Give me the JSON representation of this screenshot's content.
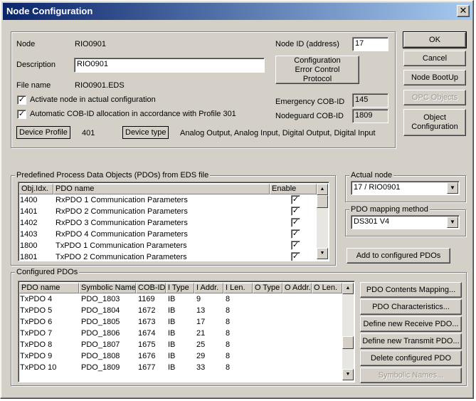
{
  "window": {
    "title": "Node Configuration",
    "close_glyph": "✕"
  },
  "node_info": {
    "node_label": "Node",
    "node_value": "RIO0901",
    "description_label": "Description",
    "description_value": "RIO0901",
    "filename_label": "File name",
    "filename_value": "RIO0901.EDS",
    "activate_label": "Activate node in actual configuration",
    "activate_checked": true,
    "auto_cob_label": "Automatic COB-ID allocation in accordance with Profile 301",
    "auto_cob_checked": true,
    "device_profile_label": "Device Profile",
    "device_profile_value": "401",
    "device_type_label": "Device type",
    "device_type_value": "Analog Output, Analog Input, Digital Output, Digital Input",
    "node_id_label": "Node ID (address)",
    "node_id_value": "17",
    "config_error_button": "Configuration Error Control Protocol",
    "emergency_label": "Emergency COB-ID",
    "emergency_value": "145",
    "nodeguard_label": "Nodeguard COB-ID",
    "nodeguard_value": "1809"
  },
  "side_buttons": {
    "ok": "OK",
    "cancel": "Cancel",
    "node_bootup": "Node BootUp",
    "opc_objects": "OPC Objects",
    "object_configuration": "Object Configuration"
  },
  "predefined": {
    "group_label": "Predefined Process Data Objects (PDOs) from EDS file",
    "columns": [
      "Obj.Idx.",
      "PDO name",
      "Enable"
    ],
    "rows": [
      {
        "idx": "1400",
        "name": "RxPDO 1 Communication Parameters",
        "enabled": true
      },
      {
        "idx": "1401",
        "name": "RxPDO 2 Communication Parameters",
        "enabled": true
      },
      {
        "idx": "1402",
        "name": "RxPDO 3 Communication Parameters",
        "enabled": true
      },
      {
        "idx": "1403",
        "name": "RxPDO 4 Communication Parameters",
        "enabled": true
      },
      {
        "idx": "1800",
        "name": "TxPDO 1 Communication Parameters",
        "enabled": true
      },
      {
        "idx": "1801",
        "name": "TxPDO 2 Communication Parameters",
        "enabled": true
      }
    ]
  },
  "actual_node": {
    "group_label": "Actual node",
    "selected": "17 / RIO0901"
  },
  "pdo_mapping": {
    "group_label": "PDO mapping method",
    "selected": "DS301 V4"
  },
  "add_button": "Add to configured PDOs",
  "configured": {
    "group_label": "Configured PDOs",
    "columns": [
      "PDO name",
      "Symbolic Name",
      "COB-ID",
      "I Type",
      "I Addr.",
      "I Len.",
      "O Type",
      "O Addr.",
      "O Len."
    ],
    "rows": [
      [
        "TxPDO 4",
        "PDO_1803",
        "1169",
        "IB",
        "9",
        "8"
      ],
      [
        "TxPDO 5",
        "PDO_1804",
        "1672",
        "IB",
        "13",
        "8"
      ],
      [
        "TxPDO 6",
        "PDO_1805",
        "1673",
        "IB",
        "17",
        "8"
      ],
      [
        "TxPDO 7",
        "PDO_1806",
        "1674",
        "IB",
        "21",
        "8"
      ],
      [
        "TxPDO 8",
        "PDO_1807",
        "1675",
        "IB",
        "25",
        "8"
      ],
      [
        "TxPDO 9",
        "PDO_1808",
        "1676",
        "IB",
        "29",
        "8"
      ],
      [
        "TxPDO 10",
        "PDO_1809",
        "1677",
        "IB",
        "33",
        "8"
      ]
    ]
  },
  "pdo_buttons": {
    "contents_mapping": "PDO Contents Mapping...",
    "characteristics": "PDO Characteristics...",
    "define_receive": "Define new Receive PDO...",
    "define_transmit": "Define new Transmit PDO...",
    "delete": "Delete configured PDO",
    "symbolic_names": "Symbolic Names..."
  }
}
